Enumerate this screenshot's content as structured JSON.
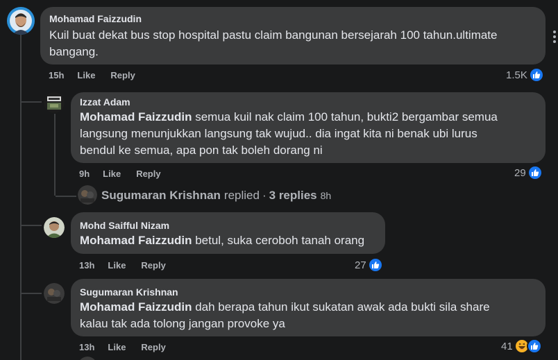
{
  "comments": [
    {
      "author": "Mohamad Faizzudin",
      "text_line1": "Kuil buat dekat bus stop hospital pastu claim bangunan bersejarah 100 tahun.ultimate",
      "text_line2": "bangang.",
      "time": "15h",
      "like_label": "Like",
      "reply_label": "Reply",
      "reaction_count": "1.5K",
      "reaction": "like"
    },
    {
      "author": "Izzat Adam",
      "mention": "Mohamad Faizzudin",
      "text_line1": " semua kuil nak claim 100 tahun, bukti2 bergambar semua",
      "text_line2": "langsung menunjukkan langsung tak wujud.. dia ingat kita ni benak ubi lurus",
      "text_line3": "bendul ke semua, apa pon tak boleh dorang ni",
      "time": "9h",
      "like_label": "Like",
      "reply_label": "Reply",
      "reaction_count": "29",
      "reaction": "like"
    },
    {
      "author": "Mohd Saifful Nizam",
      "mention": "Mohamad Faizzudin",
      "text_line1": " betul, suka ceroboh tanah orang",
      "time": "13h",
      "like_label": "Like",
      "reply_label": "Reply",
      "reaction_count": "27",
      "reaction": "like"
    },
    {
      "author": "Sugumaran Krishnan",
      "mention": "Mohamad Faizzudin",
      "text_line1": " dah berapa tahun ikut sukatan awak ada bukti sila share",
      "text_line2": "kalau tak ada tolong jangan provoke ya",
      "time": "13h",
      "like_label": "Like",
      "reply_label": "Reply",
      "reaction_count": "41",
      "reaction": "haha"
    }
  ],
  "replies_summary": {
    "name": "Sugumaran Krishnan",
    "action": "replied",
    "separator": "·",
    "count": "3 replies",
    "time": "8h"
  },
  "colors": {
    "background": "#18191a",
    "bubble": "#3a3b3c",
    "text": "#e4e6eb",
    "secondary": "#b0b3b8",
    "like_blue": "#1877f2",
    "haha_yellow": "#f7b125"
  }
}
